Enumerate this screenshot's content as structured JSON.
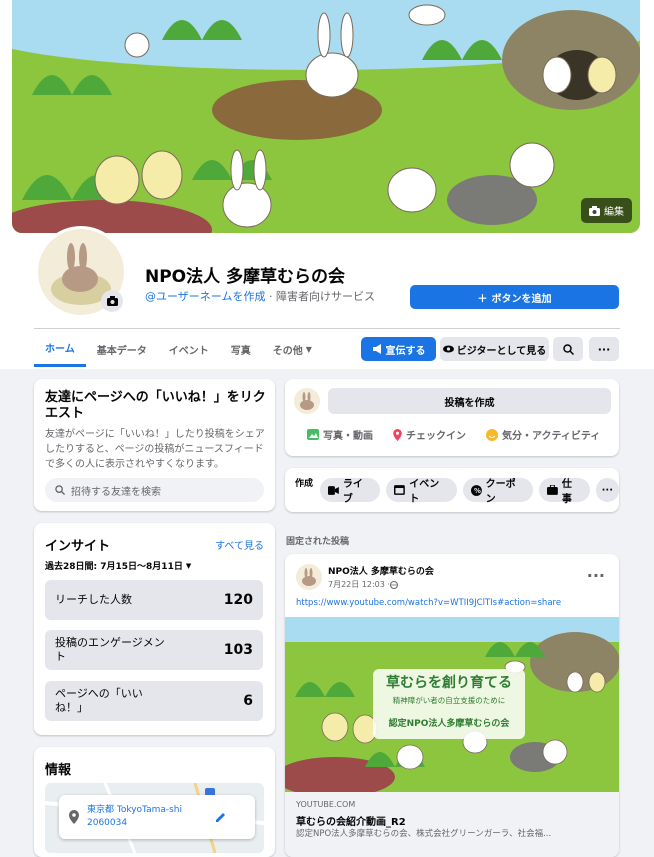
{
  "cover": {
    "edit_label": "編集"
  },
  "profile": {
    "name": "NPO法人 多摩草むらの会",
    "username_link": "@ユーザーネームを作成",
    "category": " · 障害者向けサービス",
    "add_button_label": "ボタンを追加"
  },
  "tabs": [
    {
      "label": "ホーム"
    },
    {
      "label": "基本データ"
    },
    {
      "label": "イベント"
    },
    {
      "label": "写真"
    },
    {
      "label": "その他"
    }
  ],
  "actions": {
    "promote_label": "宣伝する",
    "visitor_label": "ビジターとして見る"
  },
  "invite": {
    "title": "友達にページへの「いいね！」をリクエスト",
    "description": "友達がページに「いいね！」したり投稿をシェアしたりすると、ページの投稿がニュースフィードで多くの人に表示されやすくなります。",
    "search_placeholder": "招待する友達を検索"
  },
  "insights": {
    "title": "インサイト",
    "see_all": "すべて見る",
    "period": "過去28日間: 7月15日～8月11日",
    "stats": [
      {
        "label": "リーチした人数",
        "value": "120"
      },
      {
        "label": "投稿のエンゲージメント",
        "value": "103"
      },
      {
        "label": "ページへの「いいね！」",
        "value": "6"
      }
    ]
  },
  "info": {
    "title": "情報",
    "address": "東京都 TokyoTama-shi 2060034"
  },
  "composer": {
    "create_post": "投稿を作成",
    "photo_video": "写真・動画",
    "checkin": "チェックイン",
    "feeling": "気分・アクティビティ"
  },
  "create_bar": {
    "label": "作成",
    "chips": [
      "ライブ",
      "イベント",
      "クーポン",
      "仕事"
    ]
  },
  "pinned": {
    "section_label": "固定された投稿",
    "author": "NPO法人 多摩草むらの会",
    "time": "7月22日 12:03 · ",
    "link": "https://www.youtube.com/watch?v=WTII9JClTIs#action=share",
    "video_title": "草むらを創り育てる",
    "video_subtitle": "精神障がい者の自立支援のために",
    "video_org": "認定NPO法人多摩草むらの会",
    "preview_domain": "YOUTUBE.COM",
    "preview_title": "草むらの会紹介動画_R2",
    "preview_desc": "認定NPO法人多摩草むらの会、株式会社グリーンガーラ、社会福..."
  },
  "colors": {
    "accent": "#1b74e4",
    "bg": "#f0f2f5"
  }
}
